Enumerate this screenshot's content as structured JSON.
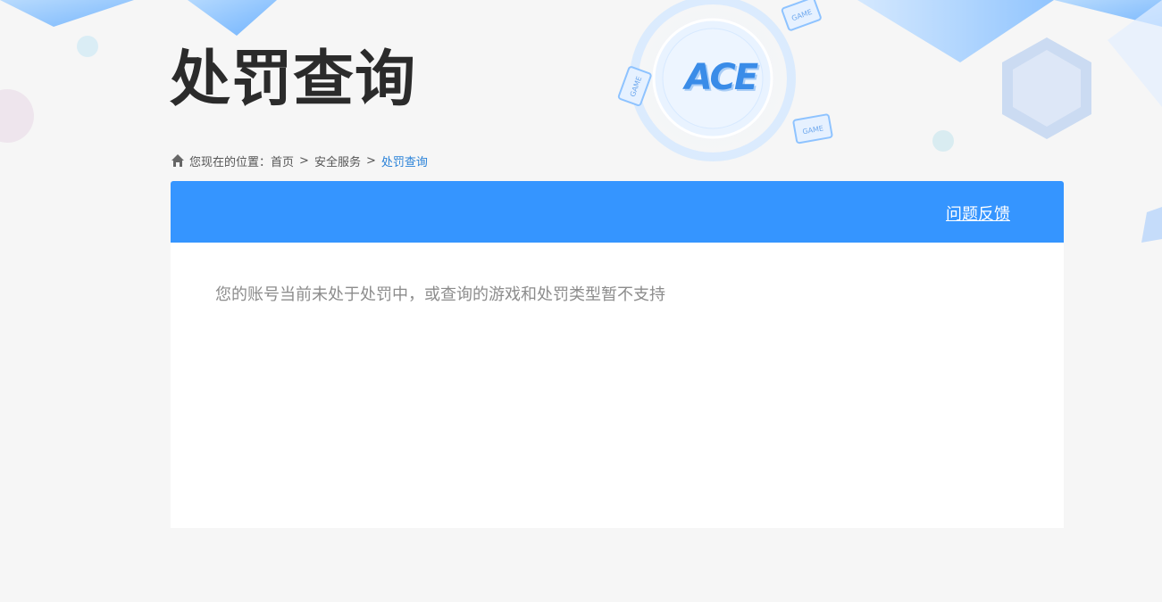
{
  "page": {
    "title": "处罚查询"
  },
  "breadcrumb": {
    "prefix": "您现在的位置：",
    "items": [
      "首页",
      "安全服务",
      "处罚查询"
    ],
    "separator": ">"
  },
  "card": {
    "feedback_label": "问题反馈",
    "message": "您的账号当前未处于处罚中，或查询的游戏和处罚类型暂不支持"
  },
  "logo": {
    "text": "ACE",
    "badge_text": "GAME"
  },
  "colors": {
    "header_blue": "#3595ff",
    "breadcrumb_current": "#2a82d8",
    "title": "#2b2b2b",
    "message": "#8c8c8c",
    "background": "#f6f6f6"
  },
  "icons": {
    "breadcrumb": "home-icon"
  }
}
